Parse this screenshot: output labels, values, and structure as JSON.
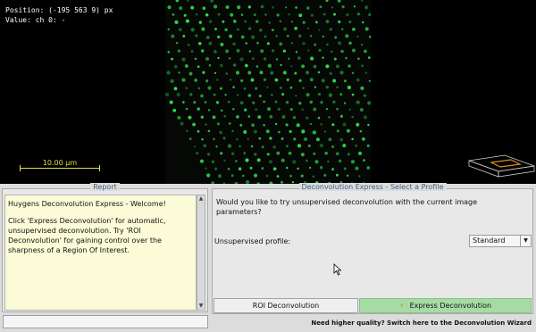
{
  "viewer": {
    "position_readout": "Position: (-195 563 9) px",
    "value_readout": "Value: ch 0: -",
    "scale_bar": "10.00 µm"
  },
  "report": {
    "title": "Report",
    "welcome": "Huygens Deconvolution Express - Welcome!",
    "instructions": "Click 'Express Deconvolution' for automatic, unsupervised deconvolution. Try 'ROI Deconvolution' for gaining control over the sharpness of a Region Of Interest."
  },
  "express": {
    "title": "Deconvolution Express - Select a Profile",
    "question": "Would you like to try unsupervised deconvolution with the current image parameters?",
    "profile_label": "Unsupervised profile:",
    "profile_value": "Standard",
    "roi_button": "ROI Deconvolution",
    "express_button": "Express Deconvolution"
  },
  "footer": {
    "wizard_link": "Need higher quality? Switch here to the Deconvolution Wizard"
  },
  "colors": {
    "spots": "#2fe04a",
    "scale_bar": "#e3df45",
    "express_button": "#a6dca4",
    "panel_title": "#3b5f86",
    "report_bg": "#fbfbd8"
  },
  "icons": [
    "lightning-icon",
    "chevron-down-icon",
    "scroll-up-icon",
    "scroll-down-icon",
    "mouse-pointer-icon"
  ]
}
